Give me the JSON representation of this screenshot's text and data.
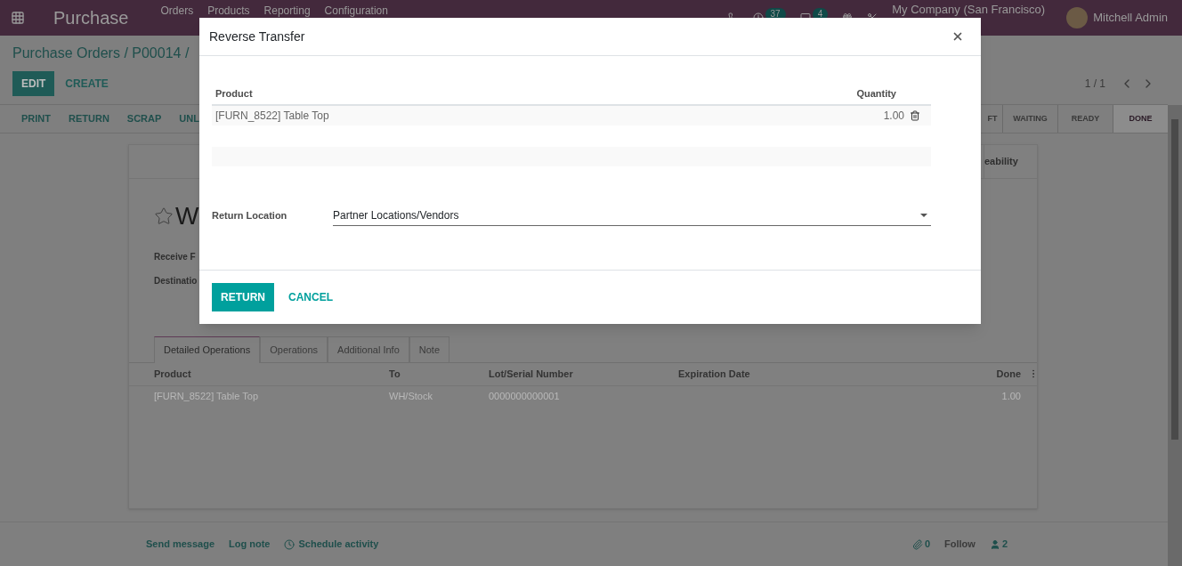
{
  "navbar": {
    "app_name": "Purchase",
    "menu": [
      "Orders",
      "Products",
      "Reporting",
      "Configuration"
    ],
    "activity_count": "37",
    "message_count": "4",
    "company": "My Company (San Francisco)",
    "user": "Mitchell Admin"
  },
  "breadcrumb": "Purchase Orders / P00014 /",
  "control_buttons": [
    {
      "label": "EDIT",
      "kind": "primary"
    },
    {
      "label": "CREATE",
      "kind": "link"
    }
  ],
  "pager": "1 / 1",
  "actions": [
    "PRINT",
    "RETURN",
    "SCRAP",
    "UNL"
  ],
  "stages": [
    {
      "label": "FT",
      "selected": false
    },
    {
      "label": "WAITING",
      "selected": false
    },
    {
      "label": "READY",
      "selected": false
    },
    {
      "label": "DONE",
      "selected": true
    }
  ],
  "sheet": {
    "smart_button": "eability",
    "title": "W",
    "starred": false,
    "fields": [
      "Receive F",
      "Destinatio"
    ]
  },
  "tabs": [
    {
      "label": "Detailed Operations",
      "selected": true
    },
    {
      "label": "Operations",
      "selected": false
    },
    {
      "label": "Additional Info",
      "selected": false
    },
    {
      "label": "Note",
      "selected": false
    }
  ],
  "table": {
    "columns": [
      "Product",
      "To",
      "Lot/Serial Number",
      "Expiration Date",
      "Done"
    ],
    "rows": [
      {
        "product": "[FURN_8522] Table Top",
        "to": "WH/Stock",
        "lot": "0000000000001",
        "done": "1.00"
      }
    ]
  },
  "chatter": {
    "actions": [
      "Send message",
      "Log note",
      "Schedule activity"
    ],
    "attachments": "0",
    "follow": "Follow",
    "followers": "2"
  },
  "dialog": {
    "title": "Reverse Transfer",
    "columns": [
      "Product",
      "Quantity"
    ],
    "lines": [
      {
        "product": "[FURN_8522] Table Top",
        "quantity": "1.00"
      }
    ],
    "return_location": {
      "label": "Return Location",
      "value": "Partner Locations/Vendors"
    },
    "buttons": [
      {
        "label": "RETURN",
        "kind": "primary"
      },
      {
        "label": "CANCEL",
        "kind": "link"
      }
    ]
  }
}
